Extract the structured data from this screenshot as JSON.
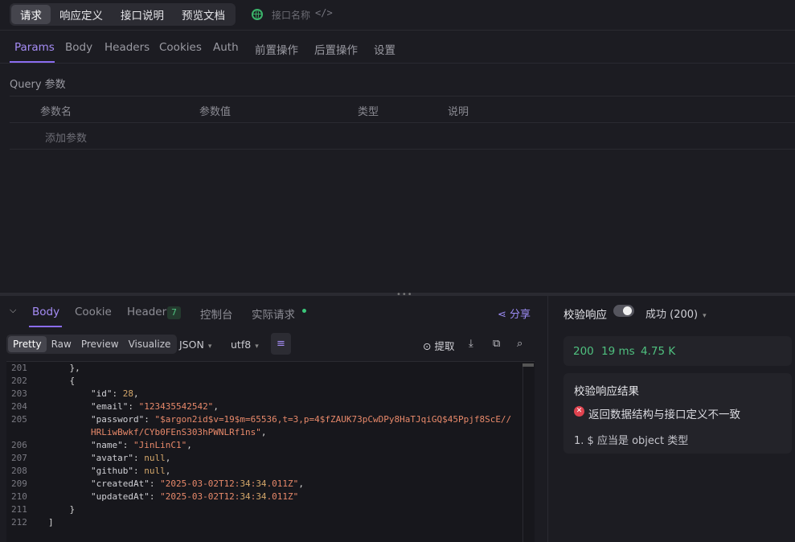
{
  "top": {
    "mode_tabs": [
      "请求",
      "响应定义",
      "接口说明",
      "预览文档"
    ],
    "active_mode": 0,
    "api_name_placeholder": "接口名称"
  },
  "request_tabs": [
    "Params",
    "Body",
    "Headers",
    "Cookies",
    "Auth",
    "前置操作",
    "后置操作",
    "设置"
  ],
  "query": {
    "title": "Query 参数",
    "headers": [
      "参数名",
      "参数值",
      "类型",
      "说明"
    ],
    "add_label": "添加参数"
  },
  "response": {
    "tabs": [
      "Body",
      "Cookie",
      "Header",
      "控制台",
      "实际请求"
    ],
    "header_count": "7",
    "share_label": "分享",
    "formats": [
      "Pretty",
      "Raw",
      "Preview",
      "Visualize"
    ],
    "type_select": "JSON",
    "encoding_select": "utf8",
    "extract_label": "提取"
  },
  "code_lines": [
    {
      "n": "201",
      "t": "    },"
    },
    {
      "n": "202",
      "t": "    {"
    },
    {
      "n": "203",
      "t": "        \"id\": 28,"
    },
    {
      "n": "204",
      "t": "        \"email\": \"123435542542\","
    },
    {
      "n": "205",
      "t": "        \"password\": \"$argon2id$v=19$m=65536,t=3,p=4$fZAUK73pCwDPy8HaTJqiGQ$45Ppjf8ScE//"
    },
    {
      "n": "",
      "t": "        HRLiwBwkf/CYb0FEnS303hPWNLRf1ns\","
    },
    {
      "n": "206",
      "t": "        \"name\": \"JinLinC1\","
    },
    {
      "n": "207",
      "t": "        \"avatar\": null,"
    },
    {
      "n": "208",
      "t": "        \"github\": null,"
    },
    {
      "n": "209",
      "t": "        \"createdAt\": \"2025-03-02T12:34:34.011Z\","
    },
    {
      "n": "210",
      "t": "        \"updatedAt\": \"2025-03-02T12:34:34.011Z\""
    },
    {
      "n": "211",
      "t": "    }"
    },
    {
      "n": "212",
      "t": "]"
    }
  ],
  "validation": {
    "label": "校验响应",
    "status_select": "成功 (200)",
    "status_code": "200",
    "time": "19 ms",
    "size": "4.75 K",
    "result_title": "校验响应结果",
    "error_message": "返回数据结构与接口定义不一致",
    "error_detail": "1. $ 应当是 object 类型"
  },
  "colors": {
    "accent": "#8b6cf0",
    "success": "#4fc07f",
    "error": "#e0434f",
    "string": "#e8896a"
  }
}
